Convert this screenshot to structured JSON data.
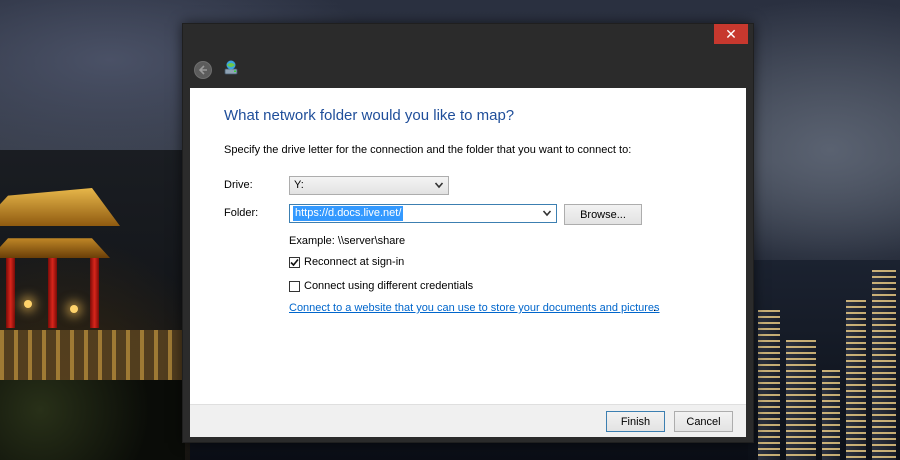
{
  "window": {
    "close_glyph": "✕"
  },
  "icons": {
    "back": "back-arrow-icon",
    "wizard": "network-drive-icon",
    "close": "close-icon",
    "dropdown": "chevron-down-icon",
    "check": "checkmark-icon"
  },
  "page": {
    "heading": "What network folder would you like to map?",
    "intro": "Specify the drive letter for the connection and the folder that you want to connect to:"
  },
  "form": {
    "drive_label": "Drive:",
    "drive_value": "Y:",
    "folder_label": "Folder:",
    "folder_value": "https://d.docs.live.net/",
    "browse_label": "Browse...",
    "example_text": "Example: \\\\server\\share",
    "reconnect_label": "Reconnect at sign-in",
    "reconnect_checked": true,
    "credentials_label": "Connect using different credentials",
    "credentials_checked": false,
    "link_text": "Connect to a website that you can use to store your documents and pictures",
    "link_suffix": "."
  },
  "footer": {
    "finish_label": "Finish",
    "cancel_label": "Cancel"
  },
  "colors": {
    "heading": "#1f4e9a",
    "link": "#0066cc",
    "close_button": "#c7382e",
    "selection": "#3399ff",
    "chrome": "#2b2b2b"
  }
}
